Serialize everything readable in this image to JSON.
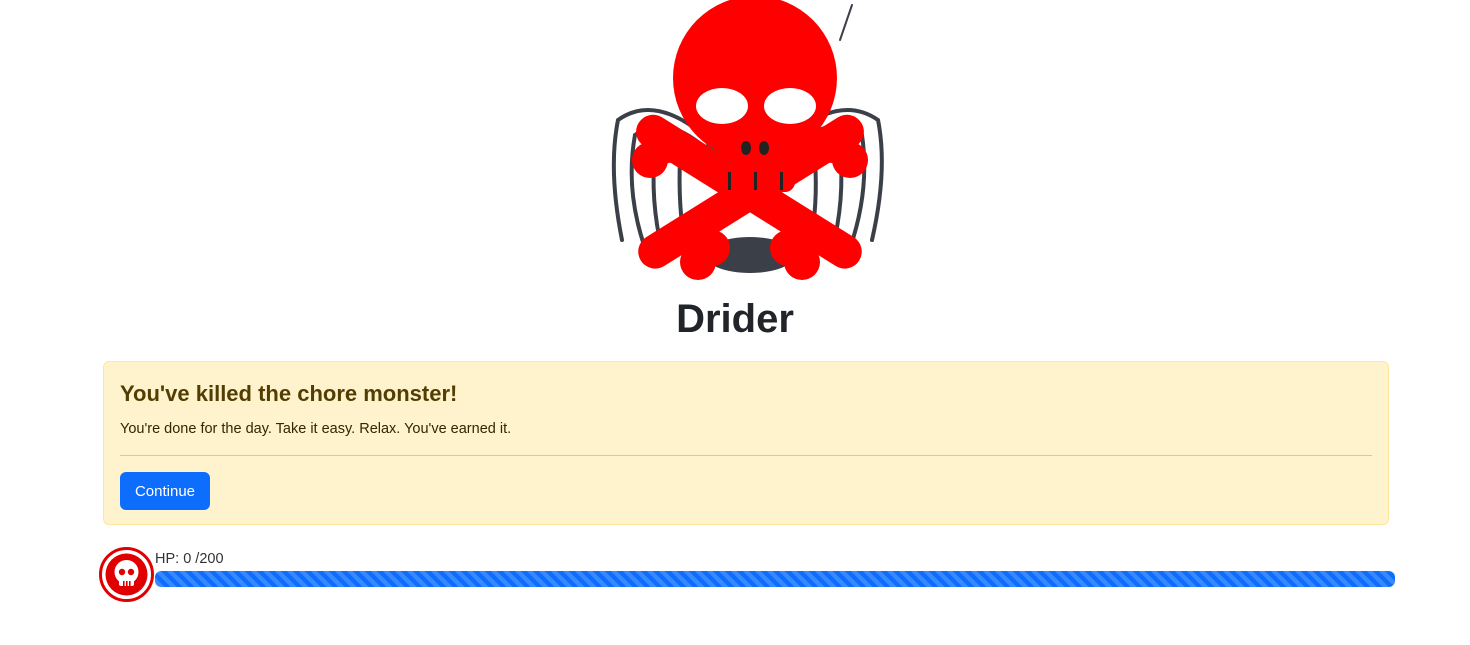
{
  "monster": {
    "name": "Drider",
    "image_icon": "spider-with-skull-crossbones-icon"
  },
  "alert": {
    "title": "You've killed the chore monster!",
    "message": "You're done for the day. Take it easy. Relax. You've earned it.",
    "continue_label": "Continue"
  },
  "hp": {
    "label": "HP: 0 /200",
    "current": 0,
    "max": 200,
    "bar_fill_fraction": 1.0,
    "bar_color": "#0d6efd",
    "icon": "skull-icon"
  },
  "colors": {
    "skull_red": "#ff0000",
    "alert_bg": "#fff3cd",
    "button_blue": "#0d6efd"
  }
}
